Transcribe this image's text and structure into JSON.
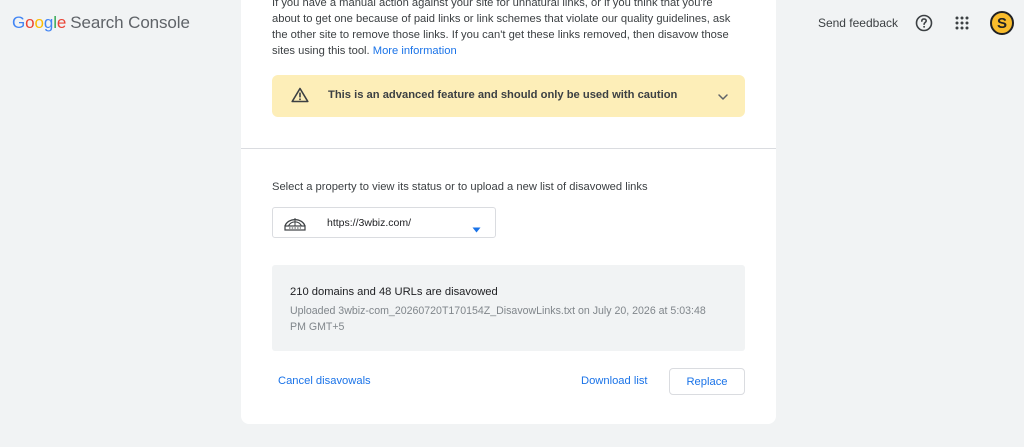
{
  "header": {
    "logo_letters": [
      "G",
      "o",
      "o",
      "g",
      "l",
      "e"
    ],
    "product_name": "Search Console",
    "send_feedback": "Send feedback",
    "help_icon": "help-circle-icon",
    "apps_icon": "apps-grid-icon",
    "avatar_letter": "S"
  },
  "intro": {
    "text": "If you have a manual action against your site for unnatural links, or if you think that you're about to get one because of paid links or link schemes that violate our quality guidelines, ask the other site to remove those links. If you can't get these links removed, then disavow those sites using this tool.",
    "link": "More information"
  },
  "caution": {
    "text": "This is an advanced feature and should only be used with caution",
    "icon": "warning-icon"
  },
  "property": {
    "label": "Select a property to view its status or to upload a new list of disavowed links",
    "selected": "https://3wbiz.com/",
    "icon": "globe-icon"
  },
  "status": {
    "title": "210 domains and 48 URLs are disavowed",
    "detail": "Uploaded 3wbiz-com_20260720T170154Z_DisavowLinks.txt on July 20, 2026 at 5:03:48 PM GMT+5"
  },
  "actions": {
    "cancel": "Cancel disavowals",
    "download": "Download list",
    "replace": "Replace"
  },
  "colors": {
    "accent": "#1a73e8",
    "caution_bg": "#fdeeb8",
    "page_bg": "#f1f3f4"
  }
}
